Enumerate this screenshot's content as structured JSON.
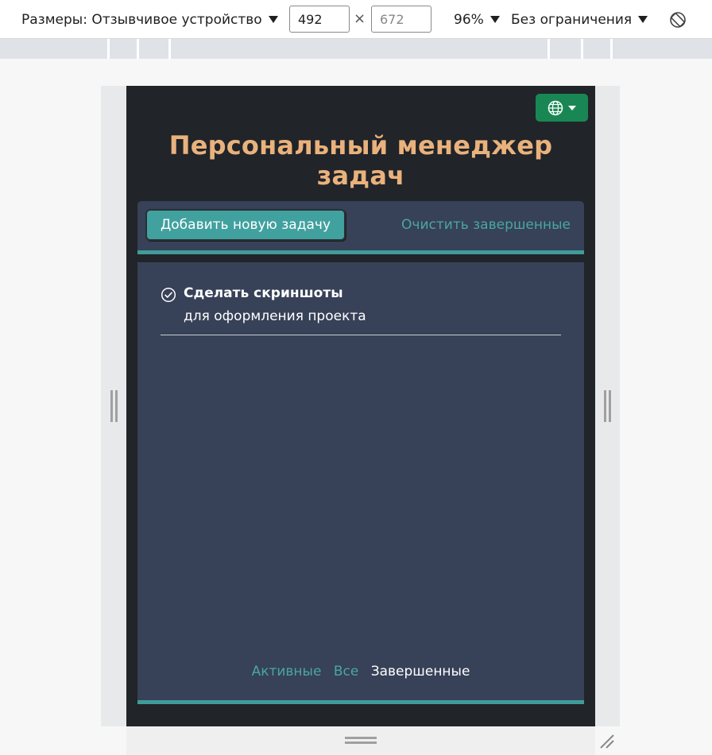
{
  "devtools": {
    "dimensions_label": "Размеры: Отзывчивое устройство",
    "width_value": "492",
    "height_placeholder": "672",
    "times_sign": "×",
    "zoom": "96%",
    "throttle": "Без ограничения"
  },
  "app": {
    "title": "Персональный менеджер задач",
    "add_task_label": "Добавить новую задачу",
    "clear_completed_label": "Очистить завершенные",
    "tasks": [
      {
        "title": "Сделать скриншоты",
        "description": "для оформления проекта",
        "completed": true
      }
    ],
    "filters": {
      "active": "Активные",
      "all": "Все",
      "completed": "Завершенные",
      "selected": "completed"
    }
  },
  "colors": {
    "page_bg": "#212429",
    "panel_bg": "#374157",
    "accent": "#41a19f",
    "title": "#e9b27c",
    "lang_button": "#198754"
  },
  "icons": {
    "language": "globe-icon",
    "task_status": "check-circle-icon",
    "rotate": "rotate-icon"
  }
}
